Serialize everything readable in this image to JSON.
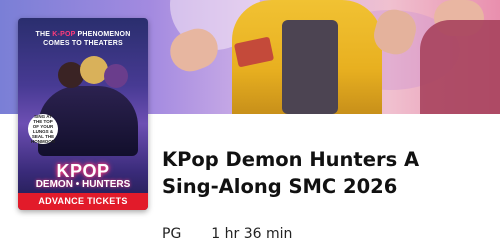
{
  "poster": {
    "tagline_pre": "THE",
    "tagline_highlight": "K-POP",
    "tagline_post": "PHENOMENON",
    "tagline_line2": "COMES TO THEATERS",
    "bubble_text": "SING AT THE TOP OF YOUR LUNGS & SEAL THE HONMOON",
    "logo_line1": "KPOP",
    "logo_line2": "DEMON • HUNTERS",
    "tickets_label": "ADVANCE TICKETS"
  },
  "movie": {
    "title": "KPop Demon Hunters A Sing-Along SMC 2026",
    "rating": "PG",
    "runtime": "1 hr 36 min"
  },
  "colors": {
    "tickets_bg": "#e21b2a",
    "hero_accent": "#f1c233"
  }
}
